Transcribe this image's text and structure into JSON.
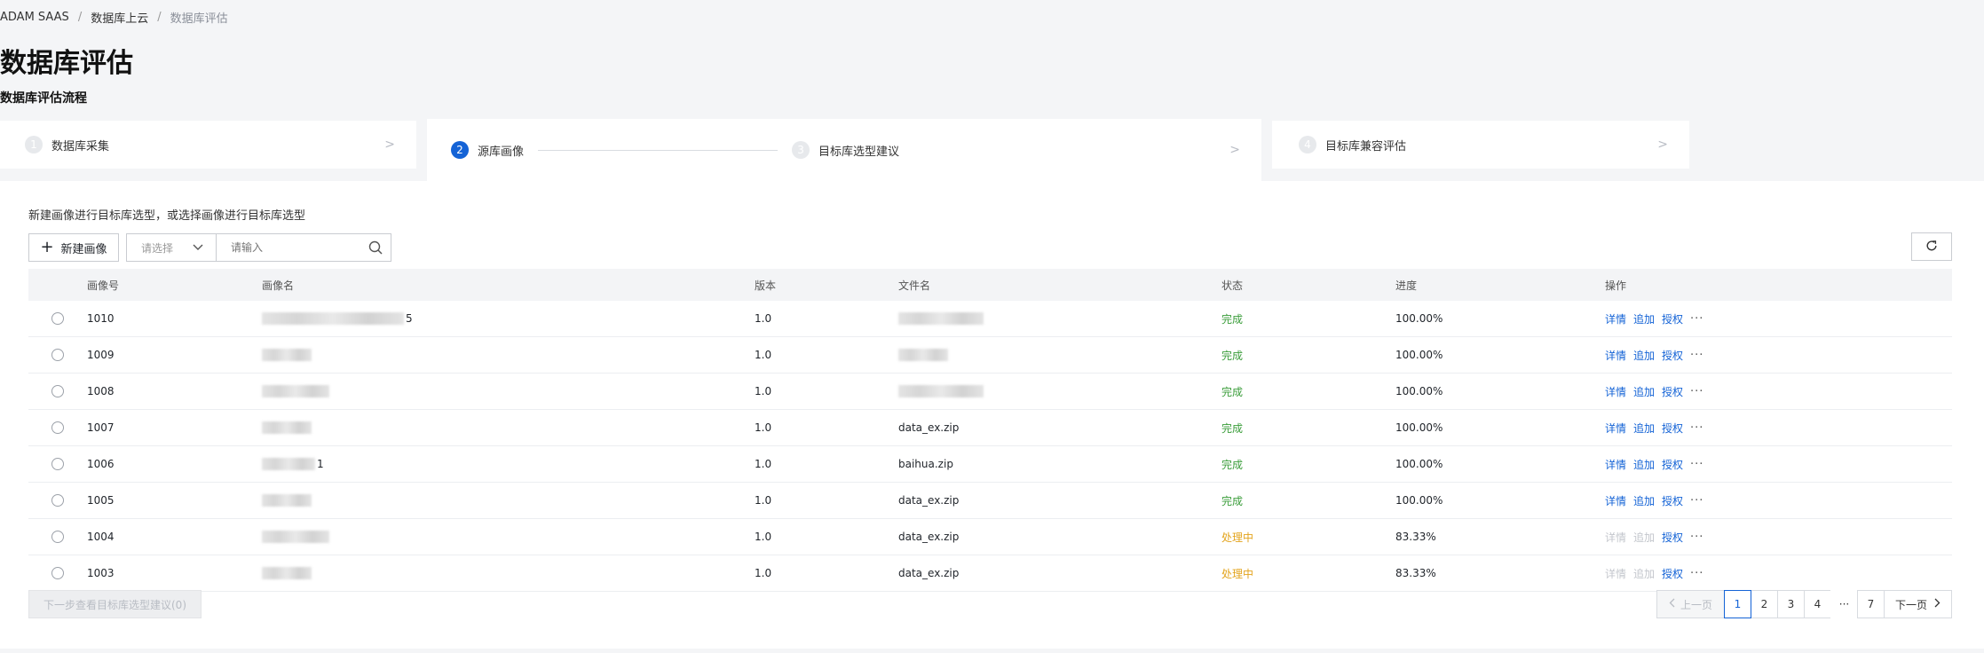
{
  "breadcrumb": {
    "items": [
      "ADAM SAAS",
      "数据库上云",
      "数据库评估"
    ]
  },
  "page": {
    "title": "数据库评估",
    "section_title": "数据库评估流程"
  },
  "steps": [
    {
      "num": "1",
      "label": "数据库采集",
      "active": false
    },
    {
      "num": "2",
      "label": "源库画像",
      "active": true
    },
    {
      "num": "3",
      "label": "目标库选型建议",
      "active": false
    },
    {
      "num": "4",
      "label": "目标库兼容评估",
      "active": false
    }
  ],
  "toolbar": {
    "hint": "新建画像进行目标库选型，或选择画像进行目标库选型",
    "new_button": "新建画像",
    "select_placeholder": "请选择",
    "search_placeholder": "请输入"
  },
  "table": {
    "columns": [
      "画像号",
      "画像名",
      "版本",
      "文件名",
      "状态",
      "进度",
      "操作"
    ],
    "actions": [
      "详情",
      "追加",
      "授权"
    ],
    "rows": [
      {
        "id": "1010",
        "name_trail": "5",
        "version": "1.0",
        "file": "",
        "status": "完成",
        "state": "done",
        "progress": "100.00%"
      },
      {
        "id": "1009",
        "name_trail": "",
        "version": "1.0",
        "file": "",
        "status": "完成",
        "state": "done",
        "progress": "100.00%"
      },
      {
        "id": "1008",
        "name_trail": "",
        "version": "1.0",
        "file": "",
        "status": "完成",
        "state": "done",
        "progress": "100.00%"
      },
      {
        "id": "1007",
        "name_trail": "",
        "version": "1.0",
        "file": "data_ex.zip",
        "status": "完成",
        "state": "done",
        "progress": "100.00%"
      },
      {
        "id": "1006",
        "name_trail": "1",
        "version": "1.0",
        "file": "baihua.zip",
        "status": "完成",
        "state": "done",
        "progress": "100.00%"
      },
      {
        "id": "1005",
        "name_trail": "",
        "version": "1.0",
        "file": "data_ex.zip",
        "status": "完成",
        "state": "done",
        "progress": "100.00%"
      },
      {
        "id": "1004",
        "name_trail": "",
        "version": "1.0",
        "file": "data_ex.zip",
        "status": "处理中",
        "state": "processing",
        "progress": "83.33%"
      },
      {
        "id": "1003",
        "name_trail": "",
        "version": "1.0",
        "file": "data_ex.zip",
        "status": "处理中",
        "state": "processing",
        "progress": "83.33%"
      }
    ]
  },
  "footer": {
    "next_step_button": "下一步查看目标库选型建议(0)"
  },
  "pagination": {
    "prev": "上一页",
    "pages": [
      "1",
      "2",
      "3",
      "4"
    ],
    "ellipsis": "···",
    "last": "7",
    "next": "下一页",
    "current": "1"
  }
}
